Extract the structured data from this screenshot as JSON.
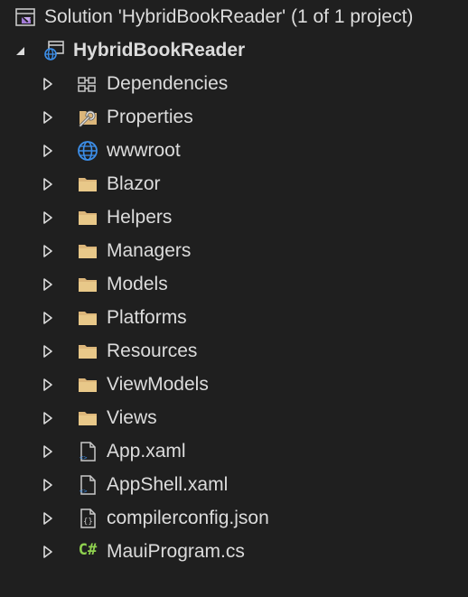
{
  "solution_explorer": {
    "solution_label": "Solution 'HybridBookReader' (1 of 1 project)",
    "project_label": "HybridBookReader",
    "items": [
      {
        "label": "Dependencies",
        "icon": "dependencies-icon"
      },
      {
        "label": "Properties",
        "icon": "properties-wrench-icon"
      },
      {
        "label": "wwwroot",
        "icon": "globe-icon"
      },
      {
        "label": "Blazor",
        "icon": "folder-icon"
      },
      {
        "label": "Helpers",
        "icon": "folder-icon"
      },
      {
        "label": "Managers",
        "icon": "folder-icon"
      },
      {
        "label": "Models",
        "icon": "folder-icon"
      },
      {
        "label": "Platforms",
        "icon": "folder-icon"
      },
      {
        "label": "Resources",
        "icon": "folder-icon"
      },
      {
        "label": "ViewModels",
        "icon": "folder-icon"
      },
      {
        "label": "Views",
        "icon": "folder-icon"
      },
      {
        "label": "App.xaml",
        "icon": "xaml-file-icon"
      },
      {
        "label": "AppShell.xaml",
        "icon": "xaml-file-icon"
      },
      {
        "label": "compilerconfig.json",
        "icon": "json-file-icon"
      },
      {
        "label": "MauiProgram.cs",
        "icon": "csharp-file-icon",
        "glyph": "C#"
      }
    ]
  },
  "colors": {
    "background": "#1f1f1f",
    "text": "#dcdcdc",
    "folder": "#dcb67a",
    "globe": "#3c8ee8",
    "csharp": "#8fd14f",
    "solution_accent": "#a27ad6"
  }
}
